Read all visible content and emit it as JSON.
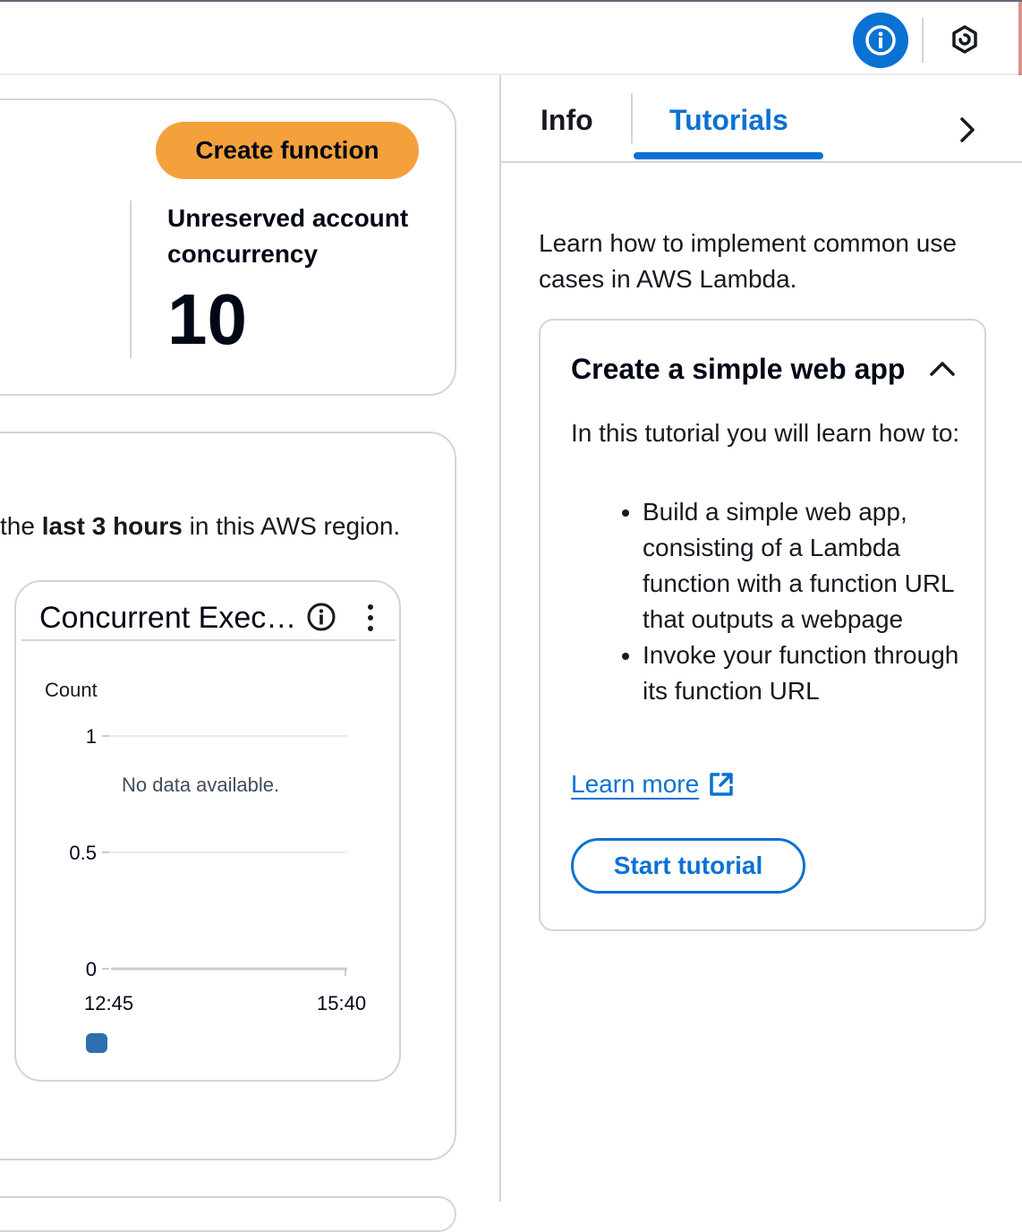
{
  "topbar": {
    "info_icon": "info-icon",
    "settings_icon": "hexagon-icon"
  },
  "overview": {
    "create_function_label": "Create function",
    "unreserved_label": "Unreserved account concurrency",
    "unreserved_value": "10"
  },
  "metrics": {
    "region_prefix": "the ",
    "region_bold": "last 3 hours",
    "region_suffix": " in this AWS region.",
    "widget": {
      "title": "Concurrent Executions",
      "info_icon": "info-icon",
      "menu_icon": "more-vertical-icon"
    }
  },
  "chart_data": {
    "type": "line",
    "title": "Concurrent Executions",
    "ylabel": "Count",
    "xlabel": "",
    "ylim": [
      0,
      1
    ],
    "yticks": [
      "1",
      "0.5",
      "0"
    ],
    "xticks": [
      "12:45",
      "15:40"
    ],
    "series": [],
    "empty_message": "No data available.",
    "legend_color": "#2e6fb0",
    "grid": true
  },
  "help_panel": {
    "tabs": [
      "Info",
      "Tutorials"
    ],
    "active_tab": "Tutorials",
    "next_icon": "chevron-right-icon",
    "intro": "Learn how to implement common use cases in AWS Lambda.",
    "tutorial": {
      "title": "Create a simple web app",
      "caret_icon": "chevron-up-icon",
      "description": "In this tutorial you will learn how to:",
      "bullets": [
        "Build a simple web app, consisting of a Lambda function with a function URL that outputs a webpage",
        "Invoke your function through its function URL"
      ],
      "learn_more": "Learn more",
      "external_icon": "external-link-icon",
      "start_label": "Start tutorial"
    }
  },
  "colors": {
    "accent": "#0972d3",
    "primary_button": "#f4a13b",
    "border": "#d1d5db"
  }
}
